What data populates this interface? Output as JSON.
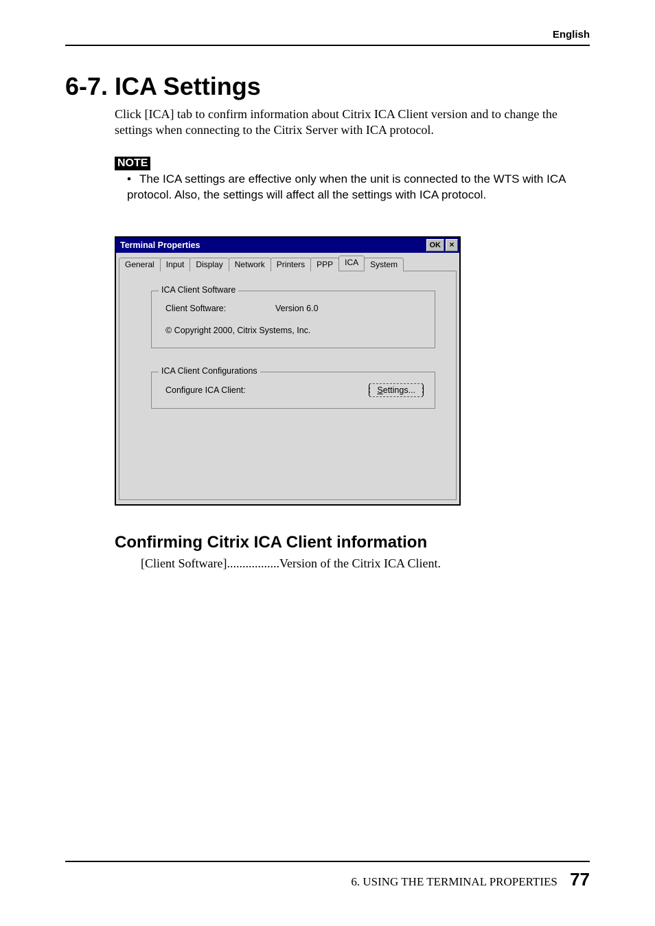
{
  "header": {
    "language": "English"
  },
  "heading": "6-7. ICA Settings",
  "intro": "Click [ICA] tab to confirm information about Citrix ICA Client version and to change the settings when connecting to the Citrix Server with ICA protocol.",
  "note": {
    "label": "NOTE",
    "text": "The ICA settings are effective only when the unit is connected to the WTS with ICA protocol.  Also, the settings will affect all the settings with ICA protocol."
  },
  "window": {
    "title": "Terminal Properties",
    "ok_label": "OK",
    "close_glyph": "×",
    "tabs": [
      "General",
      "Input",
      "Display",
      "Network",
      "Printers",
      "PPP",
      "ICA",
      "System"
    ],
    "active_tab_index": 6,
    "group_software": {
      "legend": "ICA Client Software",
      "label": "Client Software:",
      "value": "Version 6.0",
      "copyright": "© Copyright 2000, Citrix Systems, Inc."
    },
    "group_config": {
      "legend": "ICA Client Configurations",
      "label": "Configure ICA Client:",
      "button_prefix": "S",
      "button_rest": "ettings..."
    }
  },
  "subheading": "Confirming Citrix ICA Client information",
  "sub_item": "[Client Software].................Version of the Citrix ICA Client.",
  "footer": {
    "chapter": "6. USING THE TERMINAL PROPERTIES",
    "page_number": "77"
  }
}
